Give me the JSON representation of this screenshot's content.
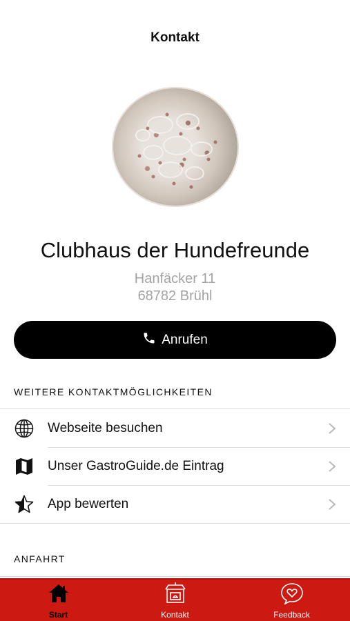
{
  "header": {
    "title": "Kontakt"
  },
  "venue": {
    "name": "Clubhaus der Hundefreunde",
    "street": "Hanfäcker 11",
    "city": "68782 Brühl",
    "image_icon": "flammkuchen-photo"
  },
  "call_button": {
    "label": "Anrufen",
    "icon": "phone-icon"
  },
  "more_contact": {
    "title": "WEITERE KONTAKTMÖGLICHKEITEN",
    "items": [
      {
        "label": "Webseite besuchen",
        "icon": "globe-icon"
      },
      {
        "label": "Unser GastroGuide.de Eintrag",
        "icon": "map-icon"
      },
      {
        "label": "App bewerten",
        "icon": "star-icon"
      }
    ]
  },
  "directions": {
    "title": "ANFAHRT"
  },
  "tabbar": {
    "tabs": [
      {
        "label": "Start",
        "icon": "home-icon",
        "active": true
      },
      {
        "label": "Kontakt",
        "icon": "restaurant-icon",
        "active": false
      },
      {
        "label": "Feedback",
        "icon": "heart-bubble-icon",
        "active": false
      }
    ]
  },
  "colors": {
    "accent": "#cc1a12",
    "button": "#000000",
    "muted_text": "#a3a3a3"
  }
}
